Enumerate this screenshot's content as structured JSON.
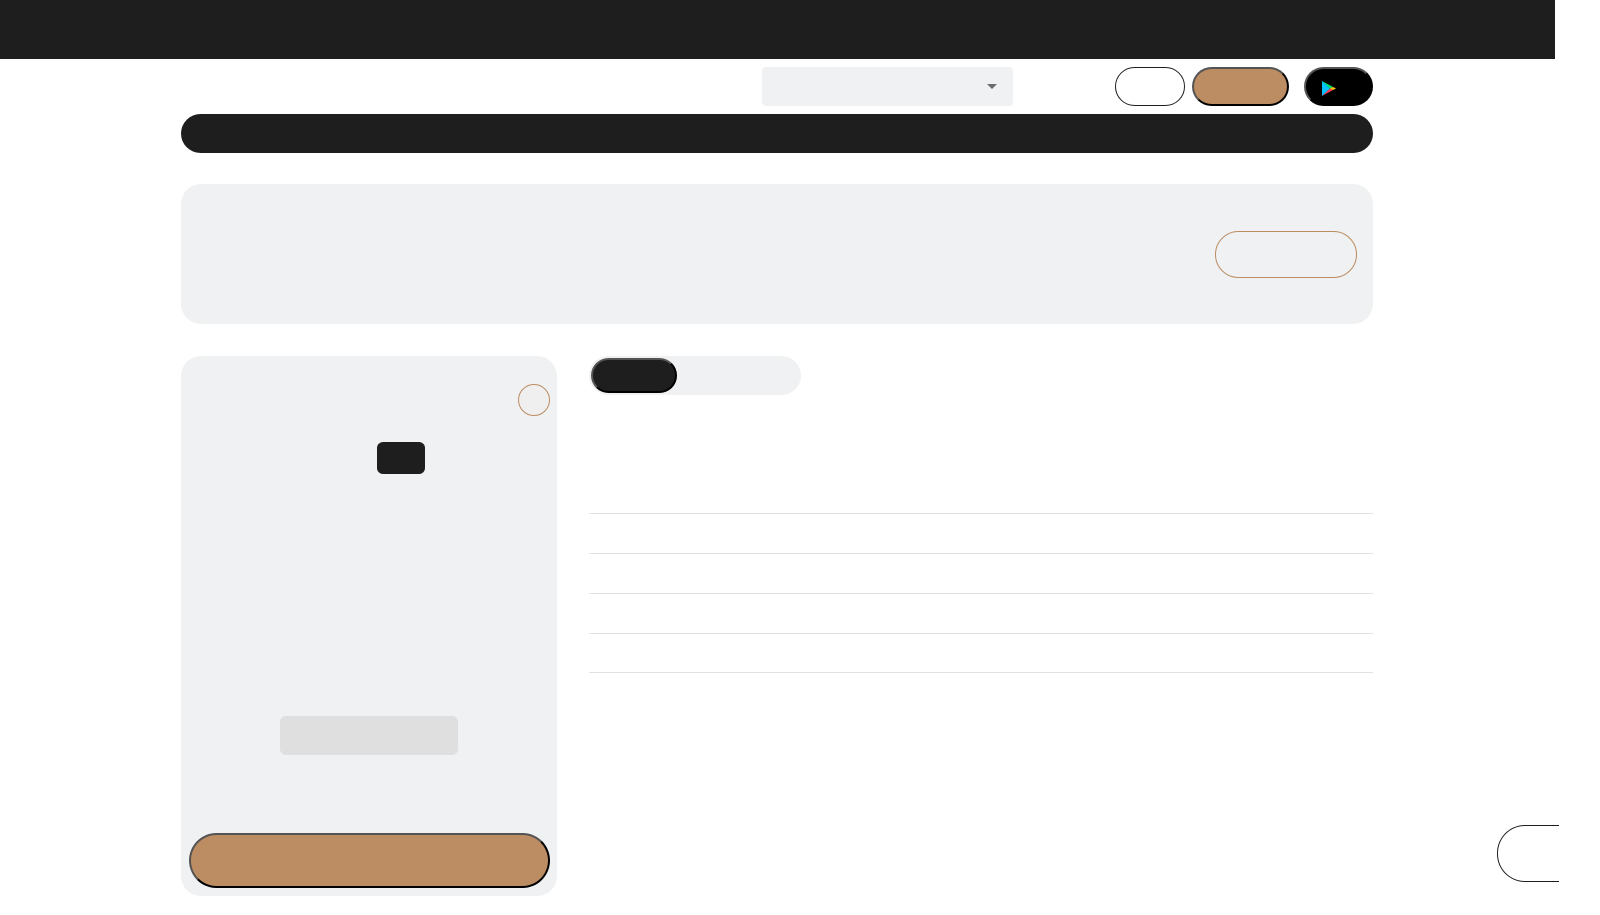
{
  "header": {
    "search_value": "",
    "login_label": "",
    "register_label": "",
    "play_icon": "google-play-icon"
  },
  "nav": {
    "items": []
  },
  "banner": {
    "text": "",
    "button_label": ""
  },
  "product_card": {
    "badge": "",
    "value": "",
    "cta_label": ""
  },
  "tabs": [
    {
      "label": "",
      "active": true
    },
    {
      "label": "",
      "active": false
    }
  ],
  "rows": [
    {
      "label": "",
      "value": ""
    },
    {
      "label": "",
      "value": ""
    },
    {
      "label": "",
      "value": ""
    },
    {
      "label": "",
      "value": ""
    }
  ],
  "colors": {
    "dark": "#1e1e1e",
    "accent": "#bc8c62",
    "surface": "#f0f1f2"
  }
}
